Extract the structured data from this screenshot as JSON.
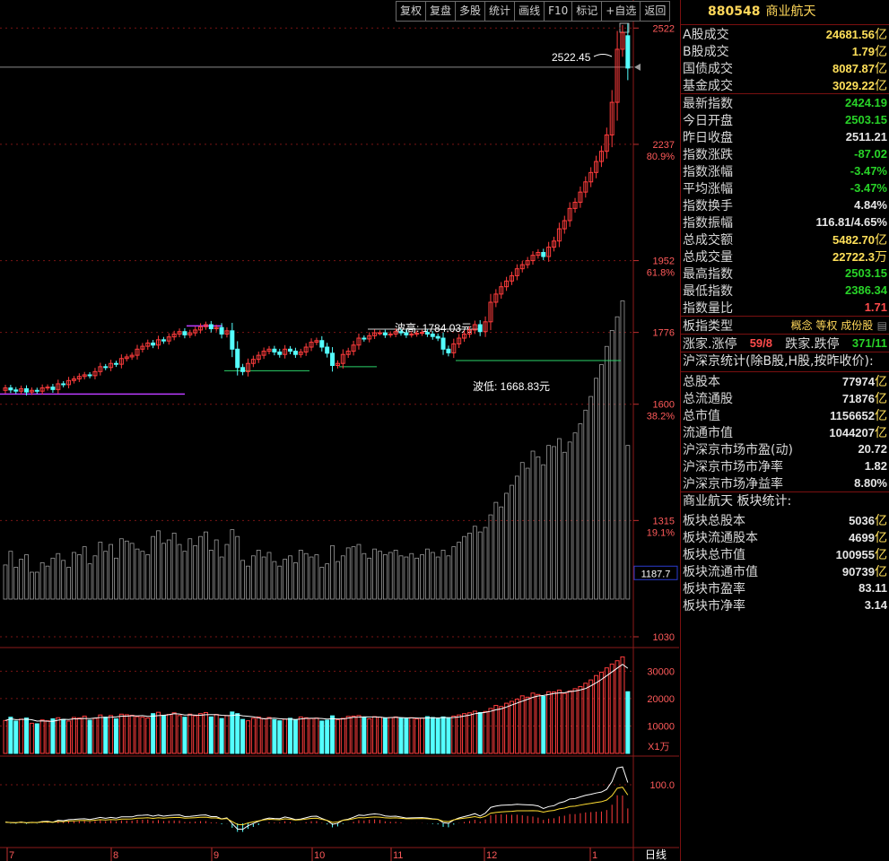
{
  "toolbar": {
    "buttons": [
      "复权",
      "复盘",
      "多股",
      "统计",
      "画线",
      "F10",
      "标记",
      "+自选",
      "返回"
    ]
  },
  "header": {
    "code": "880548",
    "name": "商业航天"
  },
  "quote": {
    "a_share_turnover_label": "A股成交",
    "a_share_turnover": "24681.56",
    "a_share_unit": "亿",
    "b_share_turnover_label": "B股成交",
    "b_share_turnover": "1.79",
    "b_share_unit": "亿",
    "bond_turnover_label": "国债成交",
    "bond_turnover": "8087.87",
    "bond_unit": "亿",
    "fund_turnover_label": "基金成交",
    "fund_turnover": "3029.22",
    "fund_unit": "亿",
    "latest_label": "最新指数",
    "latest": "2424.19",
    "open_label": "今日开盘",
    "open": "2503.15",
    "prev_close_label": "昨日收盘",
    "prev_close": "2511.21",
    "change_label": "指数涨跌",
    "change": "-87.02",
    "change_pct_label": "指数涨幅",
    "change_pct": "-3.47%",
    "avg_change_label": "平均涨幅",
    "avg_change": "-3.47%",
    "turnover_rate_label": "指数换手",
    "turnover_rate": "4.84%",
    "amplitude_label": "指数振幅",
    "amplitude": "116.81/4.65%",
    "amount_label": "总成交额",
    "amount": "5482.70",
    "amount_unit": "亿",
    "volume_label": "总成交量",
    "volume": "22722.3",
    "volume_unit": "万",
    "high_label": "最高指数",
    "high": "2503.15",
    "low_label": "最低指数",
    "low": "2386.34",
    "vol_ratio_label": "指数量比",
    "vol_ratio": "1.71",
    "index_type_label": "板指类型",
    "index_type_tags": "概念 等权 成份股",
    "up_count_label": "涨家.涨停",
    "up_count": "59/8",
    "down_count_label": "跌家.跌停",
    "down_count": "371/11"
  },
  "market": {
    "title": "沪深京统计(除B股,H股,按昨收价):",
    "rows": [
      {
        "label": "总股本",
        "value": "77974",
        "unit": "亿"
      },
      {
        "label": "总流通股",
        "value": "71876",
        "unit": "亿"
      },
      {
        "label": "总市值",
        "value": "1156652",
        "unit": "亿"
      },
      {
        "label": "流通市值",
        "value": "1044207",
        "unit": "亿"
      },
      {
        "label": "沪深京市场市盈(动)",
        "value": "20.72",
        "unit": ""
      },
      {
        "label": "沪深京市场市净率",
        "value": "1.82",
        "unit": ""
      },
      {
        "label": "沪深京市场净益率",
        "value": "8.80%",
        "unit": ""
      }
    ]
  },
  "sector": {
    "title": "商业航天 板块统计:",
    "rows": [
      {
        "label": "板块总股本",
        "value": "5036",
        "unit": "亿"
      },
      {
        "label": "板块流通股本",
        "value": "4699",
        "unit": "亿"
      },
      {
        "label": "板块总市值",
        "value": "100955",
        "unit": "亿"
      },
      {
        "label": "板块流通市值",
        "value": "90739",
        "unit": "亿"
      },
      {
        "label": "板块市盈率",
        "value": "83.11",
        "unit": ""
      },
      {
        "label": "板块市净率",
        "value": "3.14",
        "unit": ""
      }
    ]
  },
  "chart_data": {
    "type": "candlestick",
    "period": "日线",
    "price_axis": {
      "ticks": [
        {
          "value": 2522,
          "label": "2522",
          "pct": ""
        },
        {
          "value": 2237,
          "label": "2237",
          "pct": "80.9%"
        },
        {
          "value": 1952,
          "label": "1952",
          "pct": "61.8%"
        },
        {
          "value": 1776,
          "label": "1776",
          "pct": ""
        },
        {
          "value": 1600,
          "label": "1600",
          "pct": "38.2%"
        },
        {
          "value": 1315,
          "label": "1315",
          "pct": "19.1%"
        },
        {
          "value": 1030,
          "label": "1030",
          "pct": ""
        }
      ],
      "range": [
        1030,
        2560
      ],
      "crosshair_value": "1187.7"
    },
    "annotations": {
      "high_marker": "2522.45",
      "wave_high": "波高: 1784.03元",
      "wave_low": "波低: 1668.83元"
    },
    "month_labels": [
      "7",
      "8",
      "9",
      "10",
      "11",
      "12",
      "1"
    ],
    "volume_axis": {
      "ticks": [
        "30000",
        "20000",
        "10000"
      ],
      "unit_label": "X1万"
    },
    "indicator_axis": {
      "ticks": [
        "100.0"
      ]
    },
    "colors": {
      "up": "#ff3c3c",
      "down": "#54ffff",
      "ma": "#ffffff",
      "ma2": "#ffdd33",
      "chip": "#9a9a9a",
      "support": "#ba3cff",
      "wave": "#2bd36a"
    },
    "closes": [
      1640,
      1635,
      1632,
      1638,
      1630,
      1634,
      1632,
      1640,
      1642,
      1636,
      1650,
      1648,
      1658,
      1662,
      1668,
      1672,
      1670,
      1680,
      1692,
      1690,
      1700,
      1698,
      1712,
      1716,
      1720,
      1735,
      1742,
      1750,
      1745,
      1758,
      1755,
      1765,
      1772,
      1778,
      1770,
      1775,
      1782,
      1790,
      1795,
      1785,
      1788,
      1772,
      1780,
      1735,
      1690,
      1680,
      1700,
      1710,
      1720,
      1730,
      1735,
      1728,
      1722,
      1735,
      1730,
      1722,
      1728,
      1740,
      1752,
      1756,
      1740,
      1725,
      1695,
      1700,
      1722,
      1730,
      1745,
      1762,
      1760,
      1768,
      1775,
      1775,
      1770,
      1772,
      1778,
      1775,
      1770,
      1772,
      1774,
      1776,
      1772,
      1766,
      1762,
      1735,
      1726,
      1748,
      1762,
      1772,
      1782,
      1795,
      1778,
      1802,
      1850,
      1870,
      1888,
      1902,
      1915,
      1932,
      1942,
      1952,
      1965,
      1972,
      1962,
      1985,
      2000,
      2030,
      2050,
      2080,
      2095,
      2120,
      2145,
      2168,
      2195,
      2220,
      2260,
      2340,
      2470,
      2511,
      2424
    ],
    "volumes": [
      12000,
      13200,
      11800,
      12500,
      12900,
      11000,
      10800,
      12200,
      11900,
      12600,
      13000,
      12400,
      11800,
      13100,
      12900,
      13600,
      12100,
      12800,
      14000,
      13200,
      13800,
      12600,
      14300,
      14100,
      13900,
      13400,
      13200,
      12900,
      14500,
      15000,
      13900,
      14200,
      14800,
      13800,
      13200,
      14300,
      13700,
      14500,
      14900,
      13300,
      14200,
      12700,
      13800,
      15100,
      14500,
      12400,
      11900,
      12800,
      13300,
      12700,
      13100,
      12300,
      11900,
      12500,
      12800,
      12200,
      13300,
      13000,
      12700,
      12900,
      11800,
      12100,
      13700,
      12300,
      12800,
      13500,
      13600,
      13800,
      13000,
      12600,
      13400,
      13200,
      12900,
      13100,
      13300,
      12800,
      12700,
      13000,
      12600,
      12900,
      13400,
      13100,
      12700,
      13300,
      12800,
      13600,
      14000,
      14500,
      14800,
      15400,
      14900,
      15300,
      16400,
      17500,
      17100,
      18300,
      19000,
      19800,
      21000,
      20500,
      22000,
      21500,
      20800,
      22500,
      22400,
      23100,
      21900,
      22800,
      23600,
      24400,
      25600,
      26800,
      28400,
      29600,
      31200,
      32600,
      33800,
      35200,
      22500
    ]
  }
}
